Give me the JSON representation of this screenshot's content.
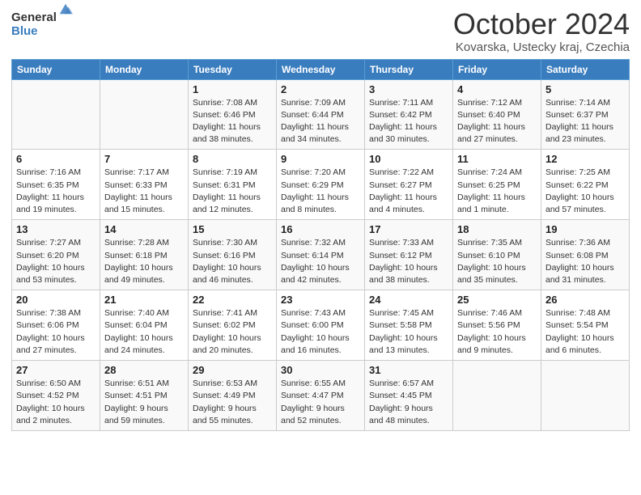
{
  "logo": {
    "general": "General",
    "blue": "Blue"
  },
  "header": {
    "month": "October 2024",
    "location": "Kovarska, Ustecky kraj, Czechia"
  },
  "weekdays": [
    "Sunday",
    "Monday",
    "Tuesday",
    "Wednesday",
    "Thursday",
    "Friday",
    "Saturday"
  ],
  "weeks": [
    [
      {
        "day": "",
        "info": ""
      },
      {
        "day": "",
        "info": ""
      },
      {
        "day": "1",
        "sunrise": "Sunrise: 7:08 AM",
        "sunset": "Sunset: 6:46 PM",
        "daylight": "Daylight: 11 hours and 38 minutes."
      },
      {
        "day": "2",
        "sunrise": "Sunrise: 7:09 AM",
        "sunset": "Sunset: 6:44 PM",
        "daylight": "Daylight: 11 hours and 34 minutes."
      },
      {
        "day": "3",
        "sunrise": "Sunrise: 7:11 AM",
        "sunset": "Sunset: 6:42 PM",
        "daylight": "Daylight: 11 hours and 30 minutes."
      },
      {
        "day": "4",
        "sunrise": "Sunrise: 7:12 AM",
        "sunset": "Sunset: 6:40 PM",
        "daylight": "Daylight: 11 hours and 27 minutes."
      },
      {
        "day": "5",
        "sunrise": "Sunrise: 7:14 AM",
        "sunset": "Sunset: 6:37 PM",
        "daylight": "Daylight: 11 hours and 23 minutes."
      }
    ],
    [
      {
        "day": "6",
        "sunrise": "Sunrise: 7:16 AM",
        "sunset": "Sunset: 6:35 PM",
        "daylight": "Daylight: 11 hours and 19 minutes."
      },
      {
        "day": "7",
        "sunrise": "Sunrise: 7:17 AM",
        "sunset": "Sunset: 6:33 PM",
        "daylight": "Daylight: 11 hours and 15 minutes."
      },
      {
        "day": "8",
        "sunrise": "Sunrise: 7:19 AM",
        "sunset": "Sunset: 6:31 PM",
        "daylight": "Daylight: 11 hours and 12 minutes."
      },
      {
        "day": "9",
        "sunrise": "Sunrise: 7:20 AM",
        "sunset": "Sunset: 6:29 PM",
        "daylight": "Daylight: 11 hours and 8 minutes."
      },
      {
        "day": "10",
        "sunrise": "Sunrise: 7:22 AM",
        "sunset": "Sunset: 6:27 PM",
        "daylight": "Daylight: 11 hours and 4 minutes."
      },
      {
        "day": "11",
        "sunrise": "Sunrise: 7:24 AM",
        "sunset": "Sunset: 6:25 PM",
        "daylight": "Daylight: 11 hours and 1 minute."
      },
      {
        "day": "12",
        "sunrise": "Sunrise: 7:25 AM",
        "sunset": "Sunset: 6:22 PM",
        "daylight": "Daylight: 10 hours and 57 minutes."
      }
    ],
    [
      {
        "day": "13",
        "sunrise": "Sunrise: 7:27 AM",
        "sunset": "Sunset: 6:20 PM",
        "daylight": "Daylight: 10 hours and 53 minutes."
      },
      {
        "day": "14",
        "sunrise": "Sunrise: 7:28 AM",
        "sunset": "Sunset: 6:18 PM",
        "daylight": "Daylight: 10 hours and 49 minutes."
      },
      {
        "day": "15",
        "sunrise": "Sunrise: 7:30 AM",
        "sunset": "Sunset: 6:16 PM",
        "daylight": "Daylight: 10 hours and 46 minutes."
      },
      {
        "day": "16",
        "sunrise": "Sunrise: 7:32 AM",
        "sunset": "Sunset: 6:14 PM",
        "daylight": "Daylight: 10 hours and 42 minutes."
      },
      {
        "day": "17",
        "sunrise": "Sunrise: 7:33 AM",
        "sunset": "Sunset: 6:12 PM",
        "daylight": "Daylight: 10 hours and 38 minutes."
      },
      {
        "day": "18",
        "sunrise": "Sunrise: 7:35 AM",
        "sunset": "Sunset: 6:10 PM",
        "daylight": "Daylight: 10 hours and 35 minutes."
      },
      {
        "day": "19",
        "sunrise": "Sunrise: 7:36 AM",
        "sunset": "Sunset: 6:08 PM",
        "daylight": "Daylight: 10 hours and 31 minutes."
      }
    ],
    [
      {
        "day": "20",
        "sunrise": "Sunrise: 7:38 AM",
        "sunset": "Sunset: 6:06 PM",
        "daylight": "Daylight: 10 hours and 27 minutes."
      },
      {
        "day": "21",
        "sunrise": "Sunrise: 7:40 AM",
        "sunset": "Sunset: 6:04 PM",
        "daylight": "Daylight: 10 hours and 24 minutes."
      },
      {
        "day": "22",
        "sunrise": "Sunrise: 7:41 AM",
        "sunset": "Sunset: 6:02 PM",
        "daylight": "Daylight: 10 hours and 20 minutes."
      },
      {
        "day": "23",
        "sunrise": "Sunrise: 7:43 AM",
        "sunset": "Sunset: 6:00 PM",
        "daylight": "Daylight: 10 hours and 16 minutes."
      },
      {
        "day": "24",
        "sunrise": "Sunrise: 7:45 AM",
        "sunset": "Sunset: 5:58 PM",
        "daylight": "Daylight: 10 hours and 13 minutes."
      },
      {
        "day": "25",
        "sunrise": "Sunrise: 7:46 AM",
        "sunset": "Sunset: 5:56 PM",
        "daylight": "Daylight: 10 hours and 9 minutes."
      },
      {
        "day": "26",
        "sunrise": "Sunrise: 7:48 AM",
        "sunset": "Sunset: 5:54 PM",
        "daylight": "Daylight: 10 hours and 6 minutes."
      }
    ],
    [
      {
        "day": "27",
        "sunrise": "Sunrise: 6:50 AM",
        "sunset": "Sunset: 4:52 PM",
        "daylight": "Daylight: 10 hours and 2 minutes."
      },
      {
        "day": "28",
        "sunrise": "Sunrise: 6:51 AM",
        "sunset": "Sunset: 4:51 PM",
        "daylight": "Daylight: 9 hours and 59 minutes."
      },
      {
        "day": "29",
        "sunrise": "Sunrise: 6:53 AM",
        "sunset": "Sunset: 4:49 PM",
        "daylight": "Daylight: 9 hours and 55 minutes."
      },
      {
        "day": "30",
        "sunrise": "Sunrise: 6:55 AM",
        "sunset": "Sunset: 4:47 PM",
        "daylight": "Daylight: 9 hours and 52 minutes."
      },
      {
        "day": "31",
        "sunrise": "Sunrise: 6:57 AM",
        "sunset": "Sunset: 4:45 PM",
        "daylight": "Daylight: 9 hours and 48 minutes."
      },
      {
        "day": "",
        "info": ""
      },
      {
        "day": "",
        "info": ""
      }
    ]
  ]
}
